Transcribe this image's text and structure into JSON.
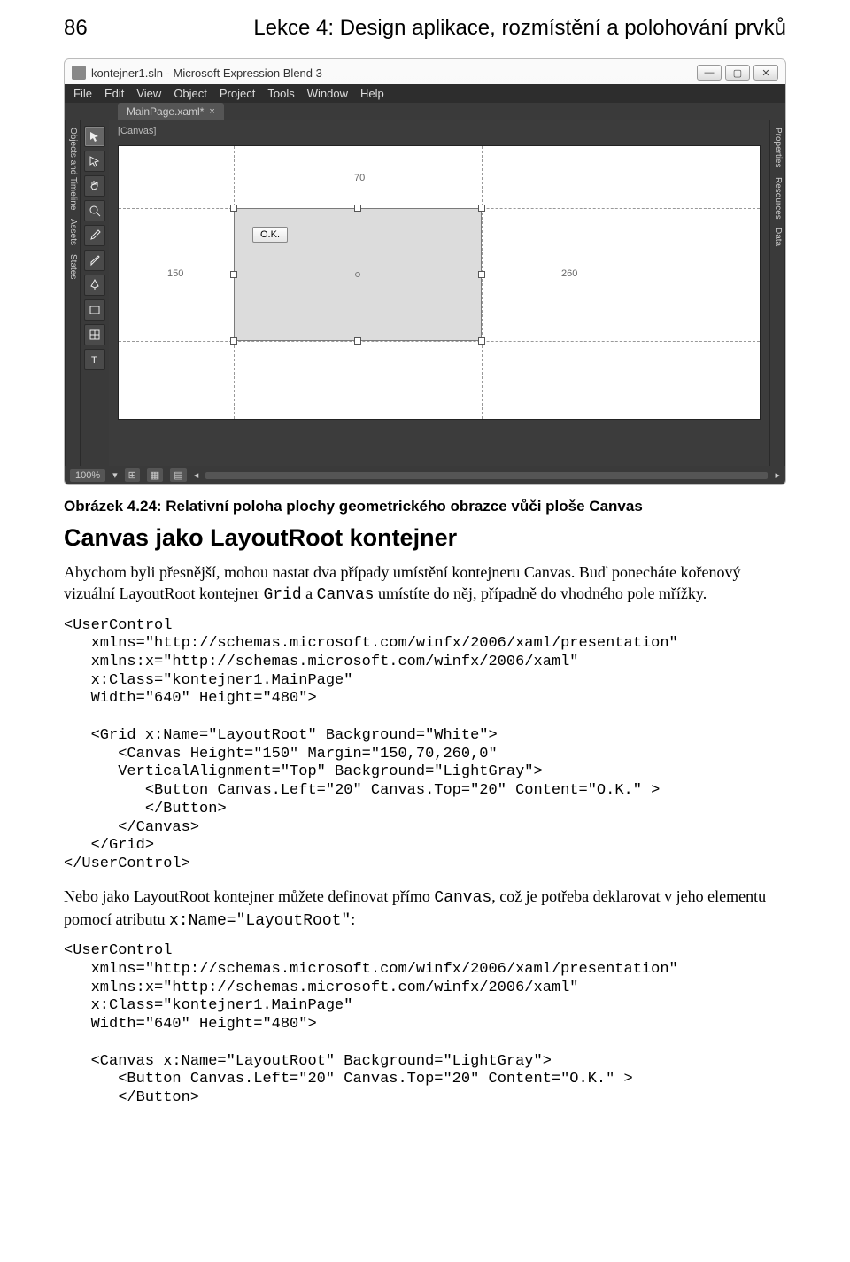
{
  "header": {
    "page_num": "86",
    "chapter": "Lekce 4: Design aplikace, rozmístění a polohování prvků"
  },
  "screenshot": {
    "title": "kontejner1.sln - Microsoft Expression Blend 3",
    "menu": [
      "File",
      "Edit",
      "View",
      "Object",
      "Project",
      "Tools",
      "Window",
      "Help"
    ],
    "tab": "MainPage.xaml*",
    "crumb": "[Canvas]",
    "left_panel_labels": [
      "Objects and Timeline",
      "Assets",
      "States"
    ],
    "right_panel_labels": [
      "Properties",
      "Resources",
      "Data"
    ],
    "button_label": "O.K.",
    "measure_left": "150",
    "measure_top": "70",
    "measure_right": "260",
    "zoom": "100%"
  },
  "fig_caption": "Obrázek 4.24: Relativní poloha plochy geometrického obrazce vůči ploše Canvas",
  "heading": "Canvas jako LayoutRoot kontejner",
  "para1_a": "Abychom byli přesnější, mohou nastat dva případy umístění kontejneru Canvas. Buď ponecháte kořenový vizuální LayoutRoot kontejner ",
  "para1_grid": "Grid",
  "para1_mid": " a ",
  "para1_canvas": "Canvas",
  "para1_b": " umístíte do něj, případně do vhodného pole mřížky.",
  "code1": "<UserControl\n   xmlns=\"http://schemas.microsoft.com/winfx/2006/xaml/presentation\"\n   xmlns:x=\"http://schemas.microsoft.com/winfx/2006/xaml\"\n   x:Class=\"kontejner1.MainPage\"\n   Width=\"640\" Height=\"480\">\n\n   <Grid x:Name=\"LayoutRoot\" Background=\"White\">\n      <Canvas Height=\"150\" Margin=\"150,70,260,0\"\n      VerticalAlignment=\"Top\" Background=\"LightGray\">\n         <Button Canvas.Left=\"20\" Canvas.Top=\"20\" Content=\"O.K.\" >\n         </Button>\n      </Canvas>\n   </Grid>\n</UserControl>",
  "para2_a": "Nebo jako LayoutRoot kontejner můžete definovat přímo ",
  "para2_canvas": "Canvas",
  "para2_b": ", což je potřeba deklarovat v jeho elementu pomocí atributu ",
  "para2_attr": "x:Name=\"LayoutRoot\"",
  "para2_c": ":",
  "code2": "<UserControl\n   xmlns=\"http://schemas.microsoft.com/winfx/2006/xaml/presentation\"\n   xmlns:x=\"http://schemas.microsoft.com/winfx/2006/xaml\"\n   x:Class=\"kontejner1.MainPage\"\n   Width=\"640\" Height=\"480\">\n\n   <Canvas x:Name=\"LayoutRoot\" Background=\"LightGray\">\n      <Button Canvas.Left=\"20\" Canvas.Top=\"20\" Content=\"O.K.\" >\n      </Button>"
}
